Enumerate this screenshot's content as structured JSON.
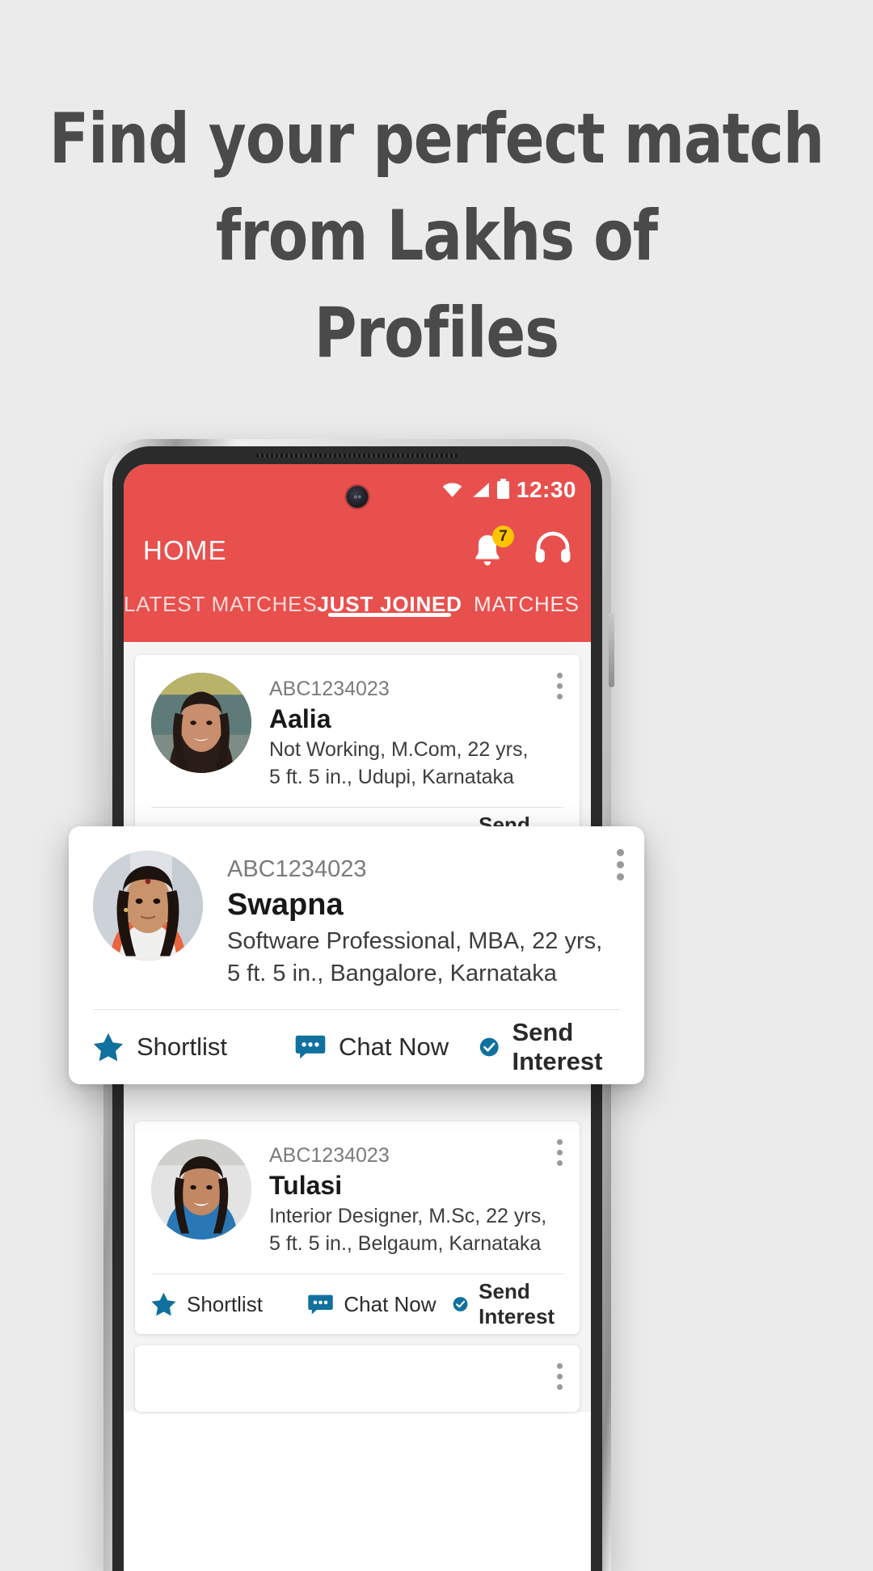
{
  "headline": {
    "line1": "Find your perfect match",
    "line2": "from Lakhs of",
    "line3": "Profiles"
  },
  "colors": {
    "background": "#ebebeb",
    "headline_text": "#4a4a4a",
    "app_header_red": "#e8504e",
    "accent_blue": "#10709e",
    "badge_yellow": "#ffc400",
    "feed_background": "#f4f4f4"
  },
  "phone": {
    "status_bar": {
      "time": "12:30",
      "icons": [
        "wifi-icon",
        "signal-icon",
        "battery-icon"
      ]
    },
    "header": {
      "title": "HOME",
      "notification_badge_count": "7",
      "icons": [
        "bell-icon",
        "headset-icon"
      ]
    },
    "tabs": [
      {
        "label": "LATEST MATCHES",
        "active": false
      },
      {
        "label": "JUST JOINED",
        "active": true
      },
      {
        "label": "MATCHES",
        "active": false
      }
    ],
    "actions": [
      {
        "label": "Shortlist",
        "icon": "star-icon"
      },
      {
        "label": "Chat Now",
        "icon": "chat-icon"
      },
      {
        "label": "Send Interest",
        "icon": "check-circle-icon"
      }
    ],
    "profiles": [
      {
        "id": "ABC1234023",
        "name": "Aalia",
        "detail_line1": "Not Working, M.Com, 22 yrs,",
        "detail_line2": "5 ft. 5 in., Udupi, Karnataka"
      },
      {
        "id": "ABC1234023",
        "name": "Tulasi",
        "detail_line1": "Interior Designer, M.Sc, 22 yrs,",
        "detail_line2": "5 ft. 5 in., Belgaum, Karnataka"
      }
    ],
    "highlighted_profile": {
      "id": "ABC1234023",
      "name": "Swapna",
      "detail_line1": "Software Professional, MBA, 22 yrs,",
      "detail_line2": "5 ft. 5 in., Bangalore, Karnataka"
    }
  }
}
